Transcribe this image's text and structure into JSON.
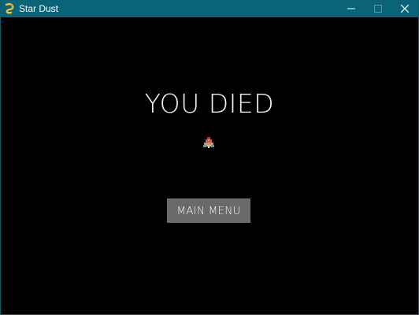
{
  "window": {
    "title": "Star Dust",
    "icon": "pygame-snake-icon",
    "controls": [
      "minimize",
      "maximize",
      "close"
    ]
  },
  "game": {
    "headline": "YOU DIED",
    "sprite": "player-ship-sprite",
    "main_menu_label": "MAIN MENU"
  },
  "colors": {
    "titlebar": "#0a6376",
    "background": "#000000",
    "button": "#6a6a6a",
    "text": "#f2f2f2"
  }
}
